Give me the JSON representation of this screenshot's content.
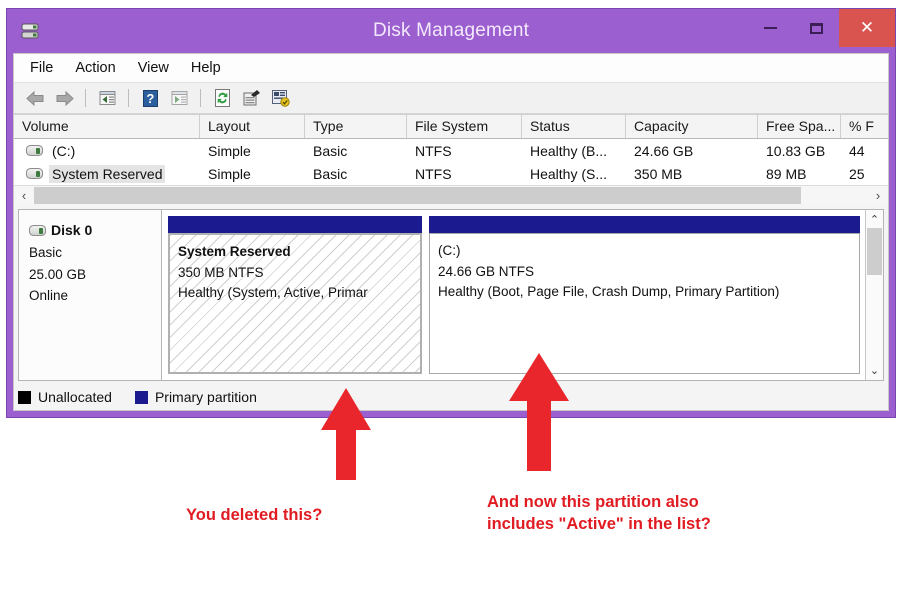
{
  "window": {
    "title": "Disk Management",
    "icon": "disk-management-icon",
    "buttons": {
      "minimize": "–",
      "maximize": "☐",
      "close": "✕"
    }
  },
  "menubar": {
    "items": [
      "File",
      "Action",
      "View",
      "Help"
    ]
  },
  "toolbar": {
    "items": [
      "back-arrow-icon",
      "forward-arrow-icon",
      "separator",
      "up-level-icon",
      "separator",
      "help-icon",
      "show-tree-icon",
      "separator",
      "refresh-icon",
      "properties-icon",
      "disk-action-icon"
    ]
  },
  "volume_list": {
    "columns": [
      "Volume",
      "Layout",
      "Type",
      "File System",
      "Status",
      "Capacity",
      "Free Spa...",
      "% F"
    ],
    "rows": [
      {
        "volume": "(C:)",
        "icon": "drive-icon",
        "selected": false,
        "layout": "Simple",
        "type": "Basic",
        "file_system": "NTFS",
        "status": "Healthy (B...",
        "capacity": "24.66 GB",
        "free_space": "10.83 GB",
        "percent_free": "44"
      },
      {
        "volume": "System Reserved",
        "icon": "drive-icon",
        "selected": true,
        "layout": "Simple",
        "type": "Basic",
        "file_system": "NTFS",
        "status": "Healthy (S...",
        "capacity": "350 MB",
        "free_space": "89 MB",
        "percent_free": "25"
      }
    ],
    "hscroll": {
      "left_arrow": "‹",
      "right_arrow": "›"
    }
  },
  "disk_view": {
    "disk": {
      "name": "Disk 0",
      "icon": "disk-icon",
      "type": "Basic",
      "capacity": "25.00 GB",
      "state": "Online"
    },
    "partitions": [
      {
        "name": "System Reserved",
        "size_fs": "350 MB NTFS",
        "status": "Healthy (System, Active, Primar",
        "selected": true,
        "bar_color": "#1b1b8f"
      },
      {
        "name": "(C:)",
        "size_fs": "24.66 GB NTFS",
        "status": "Healthy (Boot, Page File, Crash Dump, Primary Partition)",
        "selected": false,
        "bar_color": "#1b1b8f"
      }
    ],
    "vscroll": {
      "up_arrow": "⌃",
      "down_arrow": "⌄"
    }
  },
  "legend": {
    "items": [
      {
        "label": "Unallocated",
        "color": "#000000"
      },
      {
        "label": "Primary partition",
        "color": "#1b1b8f"
      }
    ]
  },
  "annotations": {
    "color": "#e01b22",
    "left_note": "You deleted this?",
    "right_note": "And now this partition also\nincludes \"Active\" in the list?",
    "arrows": [
      "up-arrow-left",
      "up-arrow-right"
    ]
  }
}
